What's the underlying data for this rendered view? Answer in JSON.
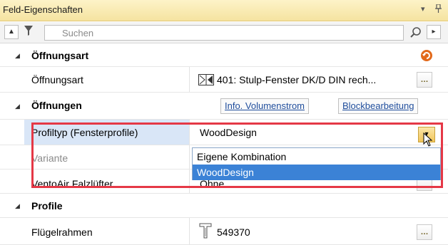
{
  "panel": {
    "title": "Feld-Eigenschaften",
    "pin_icon": "pin-icon",
    "menu_icon": "dropdown-arrow-icon"
  },
  "toolbar": {
    "collapse_icon": "caret-up-icon",
    "filter_icon": "filter-icon",
    "search_placeholder": "Suchen",
    "search_value": "",
    "search_icon": "search-icon",
    "next_icon": "arrow-right-icon"
  },
  "sections": {
    "oeffnungsart_header": "Öffnungsart",
    "oeffnungsart_label": "Öffnungsart",
    "oeffnungsart_value": "401: Stulp-Fenster DK/D DIN rech...",
    "oeffnungen_header": "Öffnungen",
    "info_button": "Info. Volumenstrom",
    "block_button": "Blockbearbeitung",
    "profiltyp_label": "Profiltyp (Fensterprofile)",
    "profiltyp_value": "WoodDesign",
    "variante_label": "Variante",
    "ventoair_label": "VentoAir Falzlüfter",
    "ventoair_value": "Ohne",
    "profile_header": "Profile",
    "fluegel_label": "Flügelrahmen",
    "fluegel_value": "549370"
  },
  "dropdown": {
    "options": [
      "Eigene Kombination",
      "WoodDesign"
    ],
    "selected": "WoodDesign"
  }
}
